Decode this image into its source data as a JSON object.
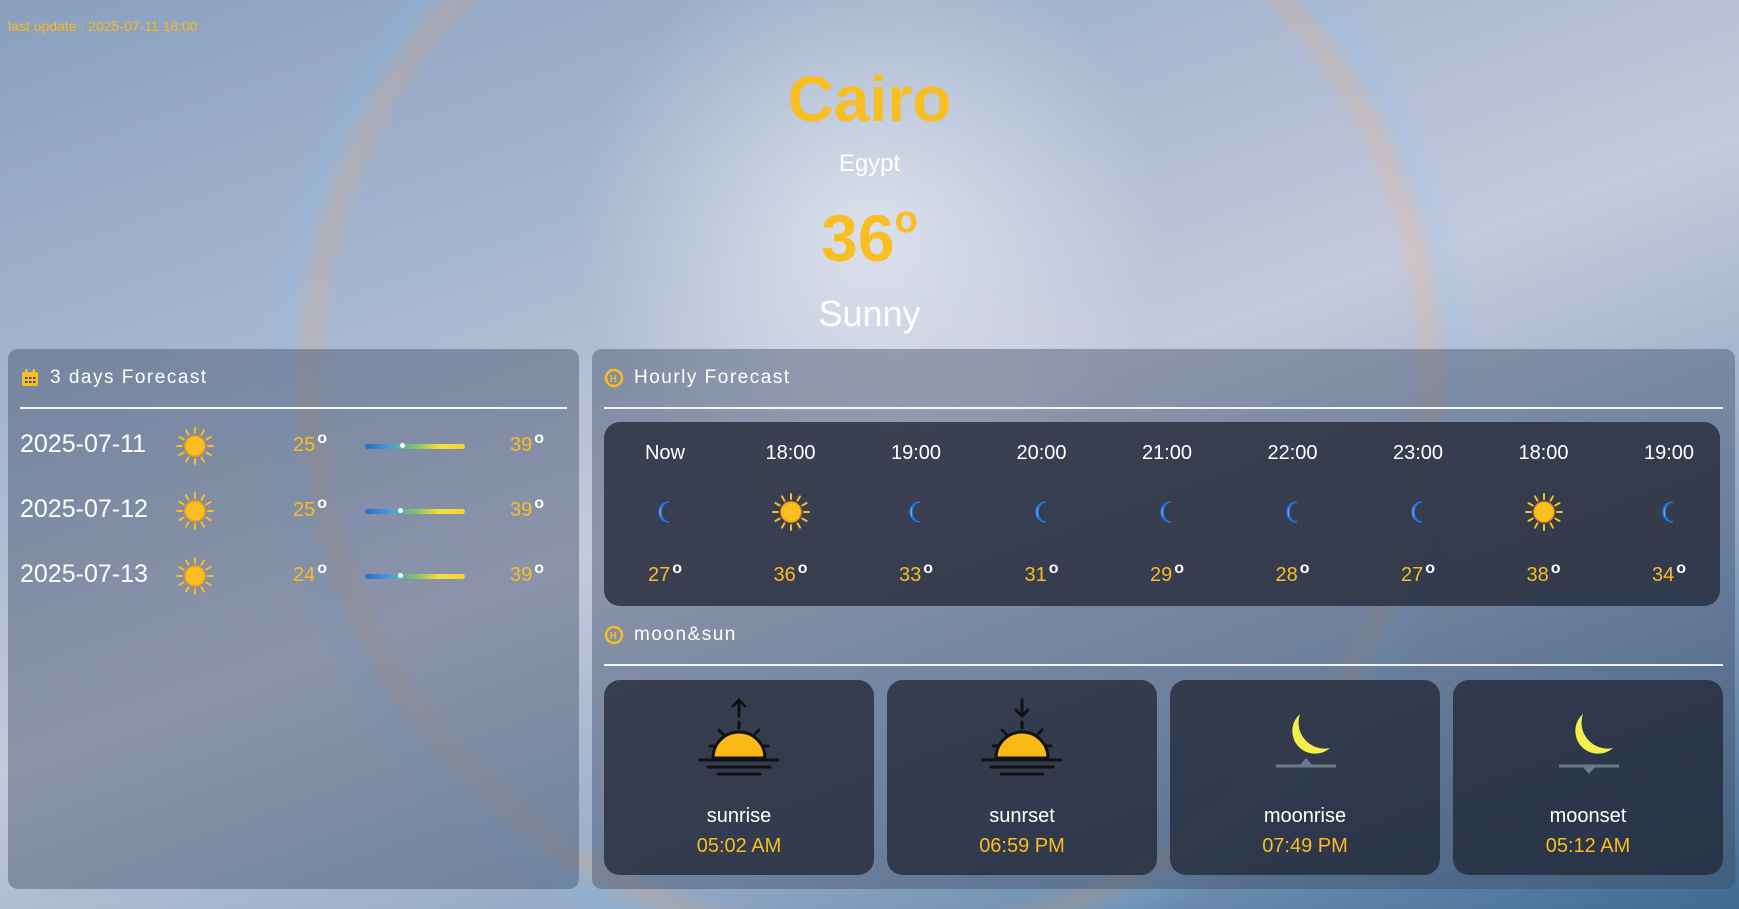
{
  "last_update": "last update : 2025-07-11 18:00",
  "location": {
    "city": "Cairo",
    "country": "Egypt"
  },
  "current": {
    "temp": "36",
    "degree_symbol": "o",
    "condition": "Sunny"
  },
  "colors": {
    "accent": "#f8be22",
    "text": "#ffffff",
    "card": "#23283a"
  },
  "forecast": {
    "title": "3 days Forecast",
    "icon": "calendar-icon",
    "days": [
      {
        "date": "2025-07-11",
        "icon": "sun-icon",
        "min": "25",
        "max": "39",
        "deg": "o",
        "marker": 0.35
      },
      {
        "date": "2025-07-12",
        "icon": "sun-icon",
        "min": "25",
        "max": "39",
        "deg": "o",
        "marker": 0.33
      },
      {
        "date": "2025-07-13",
        "icon": "sun-icon",
        "min": "24",
        "max": "39",
        "deg": "o",
        "marker": 0.33
      }
    ]
  },
  "hourly": {
    "title": "Hourly Forecast",
    "icon": "hourly-icon",
    "hours": [
      {
        "time": "Now",
        "icon": "moon-icon",
        "temp": "27",
        "deg": "o"
      },
      {
        "time": "18:00",
        "icon": "sun-icon",
        "temp": "36",
        "deg": "o"
      },
      {
        "time": "19:00",
        "icon": "moon-icon",
        "temp": "33",
        "deg": "o"
      },
      {
        "time": "20:00",
        "icon": "moon-icon",
        "temp": "31",
        "deg": "o"
      },
      {
        "time": "21:00",
        "icon": "moon-icon",
        "temp": "29",
        "deg": "o"
      },
      {
        "time": "22:00",
        "icon": "moon-icon",
        "temp": "28",
        "deg": "o"
      },
      {
        "time": "23:00",
        "icon": "moon-icon",
        "temp": "27",
        "deg": "o"
      },
      {
        "time": "18:00",
        "icon": "sun-icon",
        "temp": "38",
        "deg": "o"
      },
      {
        "time": "19:00",
        "icon": "moon-icon",
        "temp": "34",
        "deg": "o"
      }
    ]
  },
  "astro": {
    "title": "moon&sun",
    "icon": "hourly-icon",
    "items": [
      {
        "label": "sunrise",
        "time": "05:02 AM",
        "icon": "sunrise-icon"
      },
      {
        "label": "sunrset",
        "time": "06:59 PM",
        "icon": "sunset-icon"
      },
      {
        "label": "moonrise",
        "time": "07:49 PM",
        "icon": "moonrise-icon"
      },
      {
        "label": "moonset",
        "time": "05:12 AM",
        "icon": "moonset-icon"
      }
    ]
  }
}
